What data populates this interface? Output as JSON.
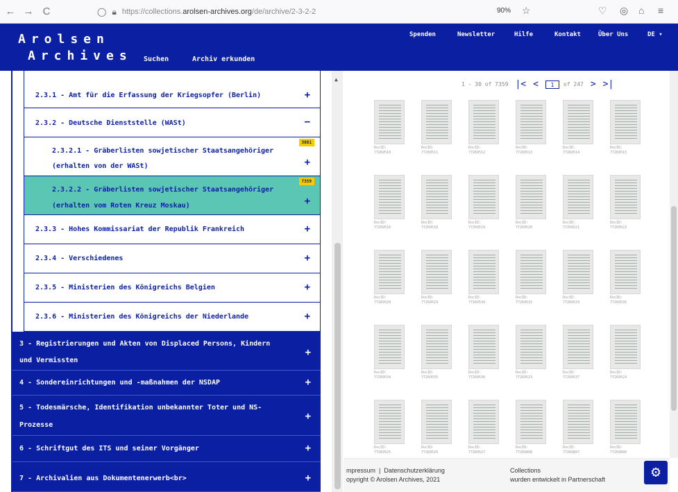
{
  "browser": {
    "back": "←",
    "forward": "→",
    "reload": "C",
    "url_prefix": "https://collections.",
    "url_host": "arolsen-archives.org",
    "url_path": "/de/archive/2-3-2-2",
    "zoom": "90%",
    "star": "☆"
  },
  "header": {
    "logo_line1": "Arolsen",
    "logo_line2": "Archives",
    "nav": [
      "Suchen",
      "Archiv erkunden"
    ],
    "top_links": [
      "Spenden",
      "Newsletter",
      "Hilfe",
      "Kontakt",
      "Über Uns",
      "DE ▾"
    ]
  },
  "tree": {
    "rows": [
      {
        "label": "2.3.1 - Amt für die Erfassung der Kriegsopfer (Berlin)",
        "control": "+"
      },
      {
        "label": "2.3.2 - Deutsche Dienststelle (WASt)",
        "control": "−"
      },
      {
        "label_line1": "2.3.2.1 - Gräberlisten sowjetischer Staatsangehöriger",
        "label_line2": "(erhalten von der WASt)",
        "badge": "3861",
        "control": "+"
      },
      {
        "label_line1": "2.3.2.2 - Gräberlisten sowjetischer Staatsangehöriger",
        "label_line2": "(erhalten vom Roten Kreuz Moskau)",
        "badge": "7359",
        "control": "+"
      },
      {
        "label": "2.3.3 - Hohes Kommissariat der Republik Frankreich",
        "control": "+"
      },
      {
        "label": "2.3.4 - Verschiedenes",
        "control": "+"
      },
      {
        "label": "2.3.5 - Ministerien des Königreichs Belgien",
        "control": "+"
      },
      {
        "label": "2.3.6 - Ministerien des Königreichs der Niederlande",
        "control": "+"
      }
    ],
    "sections": [
      {
        "line1": "3 - Registrierungen und Akten von Displaced Persons, Kindern",
        "line2": "und Vermissten",
        "control": "+"
      },
      {
        "line1": "4 - Sondereinrichtungen und -maßnahmen der NSDAP",
        "line2": "",
        "control": "+"
      },
      {
        "line1": "5 - Todesmärsche, Identifikation unbekannter Toter und NS-",
        "line2": "Prozesse",
        "control": "+"
      },
      {
        "line1": "6 - Schriftgut des ITS und seiner Vorgänger",
        "line2": "",
        "control": "+"
      },
      {
        "line1": "7 - Archivalien aus Dokumentenerwerb<br>",
        "line2": "",
        "control": "+"
      }
    ]
  },
  "viewer": {
    "range": "1 - 30 of 7359",
    "first": "|<",
    "prev": "<",
    "page": "1",
    "of_pages": "of 247",
    "next": ">",
    "last": ">|",
    "thumbs": [
      "DocID: 77269510",
      "DocID: 77269511",
      "DocID: 77269512",
      "DocID: 77269513",
      "DocID: 77269514",
      "DocID: 77269515",
      "DocID: 77269516",
      "DocID: 77269518",
      "DocID: 77269519",
      "DocID: 77269520",
      "DocID: 77269521",
      "DocID: 77269522",
      "DocID: 77269528",
      "DocID: 77269529",
      "DocID: 77269530",
      "DocID: 77269532",
      "DocID: 77269533",
      "DocID: 77269535",
      "DocID: 77269534",
      "DocID: 77269535",
      "DocID: 77269536",
      "DocID: 77269523",
      "DocID: 77269537",
      "DocID: 77269524",
      "DocID: 77269525",
      "DocID: 77269526",
      "DocID: 77269527",
      "DocID: 77269898",
      "DocID: 77269897",
      "DocID: 77269890"
    ]
  },
  "footer": {
    "impressum": "mpressum",
    "sep": "|",
    "datenschutz": "Datenschutzerklärung",
    "copyright": "opyright © Arolsen Archives, 2021",
    "collections": "Collections",
    "partner": "wurden entwickelt in Partnerschaft"
  },
  "colors": {
    "brand": "#0b1fa3",
    "selected": "#5cc6b5",
    "badge": "#f2cb00"
  }
}
